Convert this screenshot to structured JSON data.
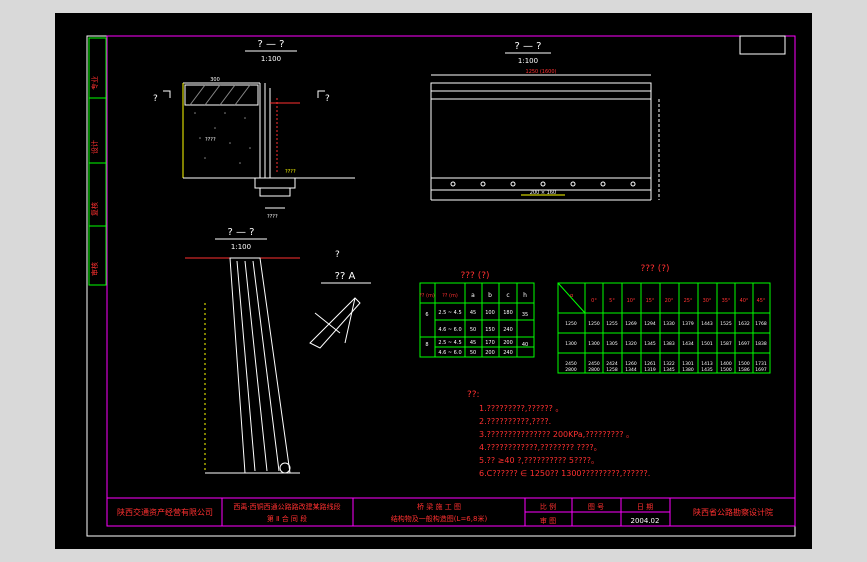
{
  "colors": {
    "background": "#000000",
    "frame": "#ffffff",
    "border_green": "#00ff00",
    "border_magenta": "#ff00ff",
    "text_red": "#ff3030",
    "text_yellow": "#ffff00",
    "line_white": "#ffffff",
    "table_green": "#00ff00"
  },
  "side_tabs": [
    "专业",
    "设计",
    "复核",
    "审核"
  ],
  "views": {
    "section1": {
      "title": "? — ?",
      "scale": "1:100",
      "dim_top": "300",
      "labels": [
        "????",
        "????",
        "????",
        "?",
        "?",
        "?"
      ]
    },
    "section2": {
      "title": "? — ?",
      "scale": "1:100",
      "dim_top": "1250 (1600)",
      "dim_bottom": "200 × 160"
    },
    "section3": {
      "title": "? — ?",
      "scale": "1:100"
    },
    "detail": {
      "title": "?? A",
      "mark": "?"
    }
  },
  "table1": {
    "title": "??? (?)",
    "headers": [
      "??\n(m)",
      "??\n(m)",
      "a",
      "b",
      "c",
      "h"
    ],
    "rows": [
      [
        "6",
        "2.5 ~ 4.5",
        "45",
        "100",
        "180",
        "35"
      ],
      [
        "",
        "4.6 ~ 6.0",
        "50",
        "150",
        "240",
        ""
      ],
      [
        "8",
        "2.5 ~ 4.5",
        "45",
        "170",
        "200",
        "40"
      ],
      [
        "",
        "4.6 ~ 6.0",
        "50",
        "200",
        "240",
        ""
      ]
    ]
  },
  "table2": {
    "title": "??? (?)",
    "corner": [
      "α",
      "B",
      "C"
    ],
    "headers": [
      "0°",
      "5°",
      "10°",
      "15°",
      "20°",
      "25°",
      "30°",
      "35°",
      "40°",
      "45°"
    ],
    "rows": [
      [
        "1250",
        "1250",
        "1255",
        "1269",
        "1294",
        "1330",
        "1379",
        "1443",
        "1525",
        "1632",
        "1768"
      ],
      [
        "1300",
        "1300",
        "1305",
        "1320",
        "1345",
        "1383",
        "1434",
        "1501",
        "1587",
        "1697",
        "1838"
      ],
      [
        "2450",
        "2450",
        "2424",
        "1260",
        "1261",
        "1322",
        "1301",
        "1413",
        "1400",
        "1500",
        "1731"
      ],
      [
        "2800",
        "2800",
        "1258",
        "1344",
        "1319",
        "1345",
        "1380",
        "1435",
        "1500",
        "1586",
        "1697"
      ]
    ]
  },
  "notes": {
    "heading": "??:",
    "items": [
      "1.?????????,??????  。",
      "2.??????????,????.",
      "3.???????????????     200KPa,?????????  。",
      "4.????????????,???????? ????。",
      "5.?? ≥40 ?,??????????     5????。",
      "6.C??????  ∈  1250??   1300?????????,??????."
    ]
  },
  "title_block": {
    "company": "陕西交通资产经营有限公司",
    "project_line1": "西禹·西铜西通公路路改建某路线段",
    "project_line2": "第 Ⅱ 合 同 段",
    "drawing_line1": "桥 梁 施 工 图",
    "drawing_line2": "结构物及一般构造图(L=6,8米)",
    "labels": [
      "比 例",
      "图 号",
      "日 期",
      "审 图"
    ],
    "date": "2004.02",
    "designer": "陕西省公路勘察设计院"
  }
}
